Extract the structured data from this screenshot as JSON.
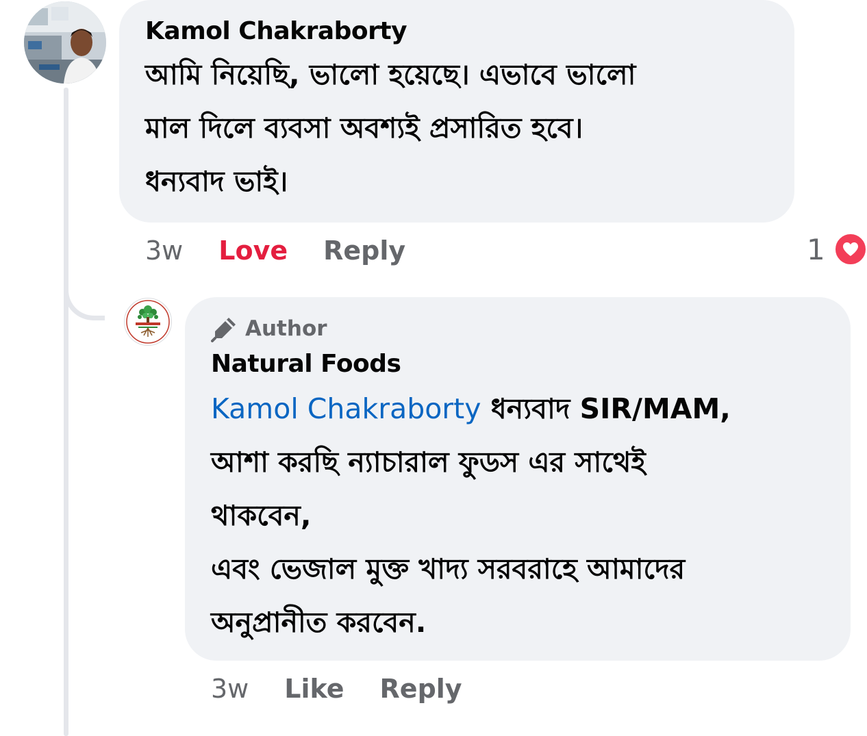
{
  "comment": {
    "author": "Kamol Chakraborty",
    "text": "আমি নিয়েছি,  ভালো হয়েছে। এভাবে ভালো\nমাল দিলে ব্যবসা অবশ্যই প্রসারিত হবে।\nধন্যবাদ ভাই।",
    "timestamp": "3w",
    "love_label": "Love",
    "reply_label": "Reply",
    "reaction_count": "1",
    "reaction_icon": "heart-icon"
  },
  "reply": {
    "badge": "Author",
    "badge_icon": "pencil-icon",
    "author": "Natural Foods",
    "mention": "Kamol Chakraborty",
    "text_line1": " ধন্যবাদ SIR/MAM,",
    "text_rest": "আশা করছি ন্যাচারাল ফুডস এর সাথেই\nথাকবেন,\nএবং ভেজাল মুক্ত খাদ্য সরবরাহে আমাদের\nঅনুপ্রানীত করবেন.",
    "timestamp": "3w",
    "like_label": "Like",
    "reply_label": "Reply"
  },
  "colors": {
    "bubble_bg": "#f0f2f5",
    "text": "#050505",
    "secondary": "#65676b",
    "love": "#e41e3f",
    "mention": "#0a66c2",
    "heart": "#f33e58"
  }
}
